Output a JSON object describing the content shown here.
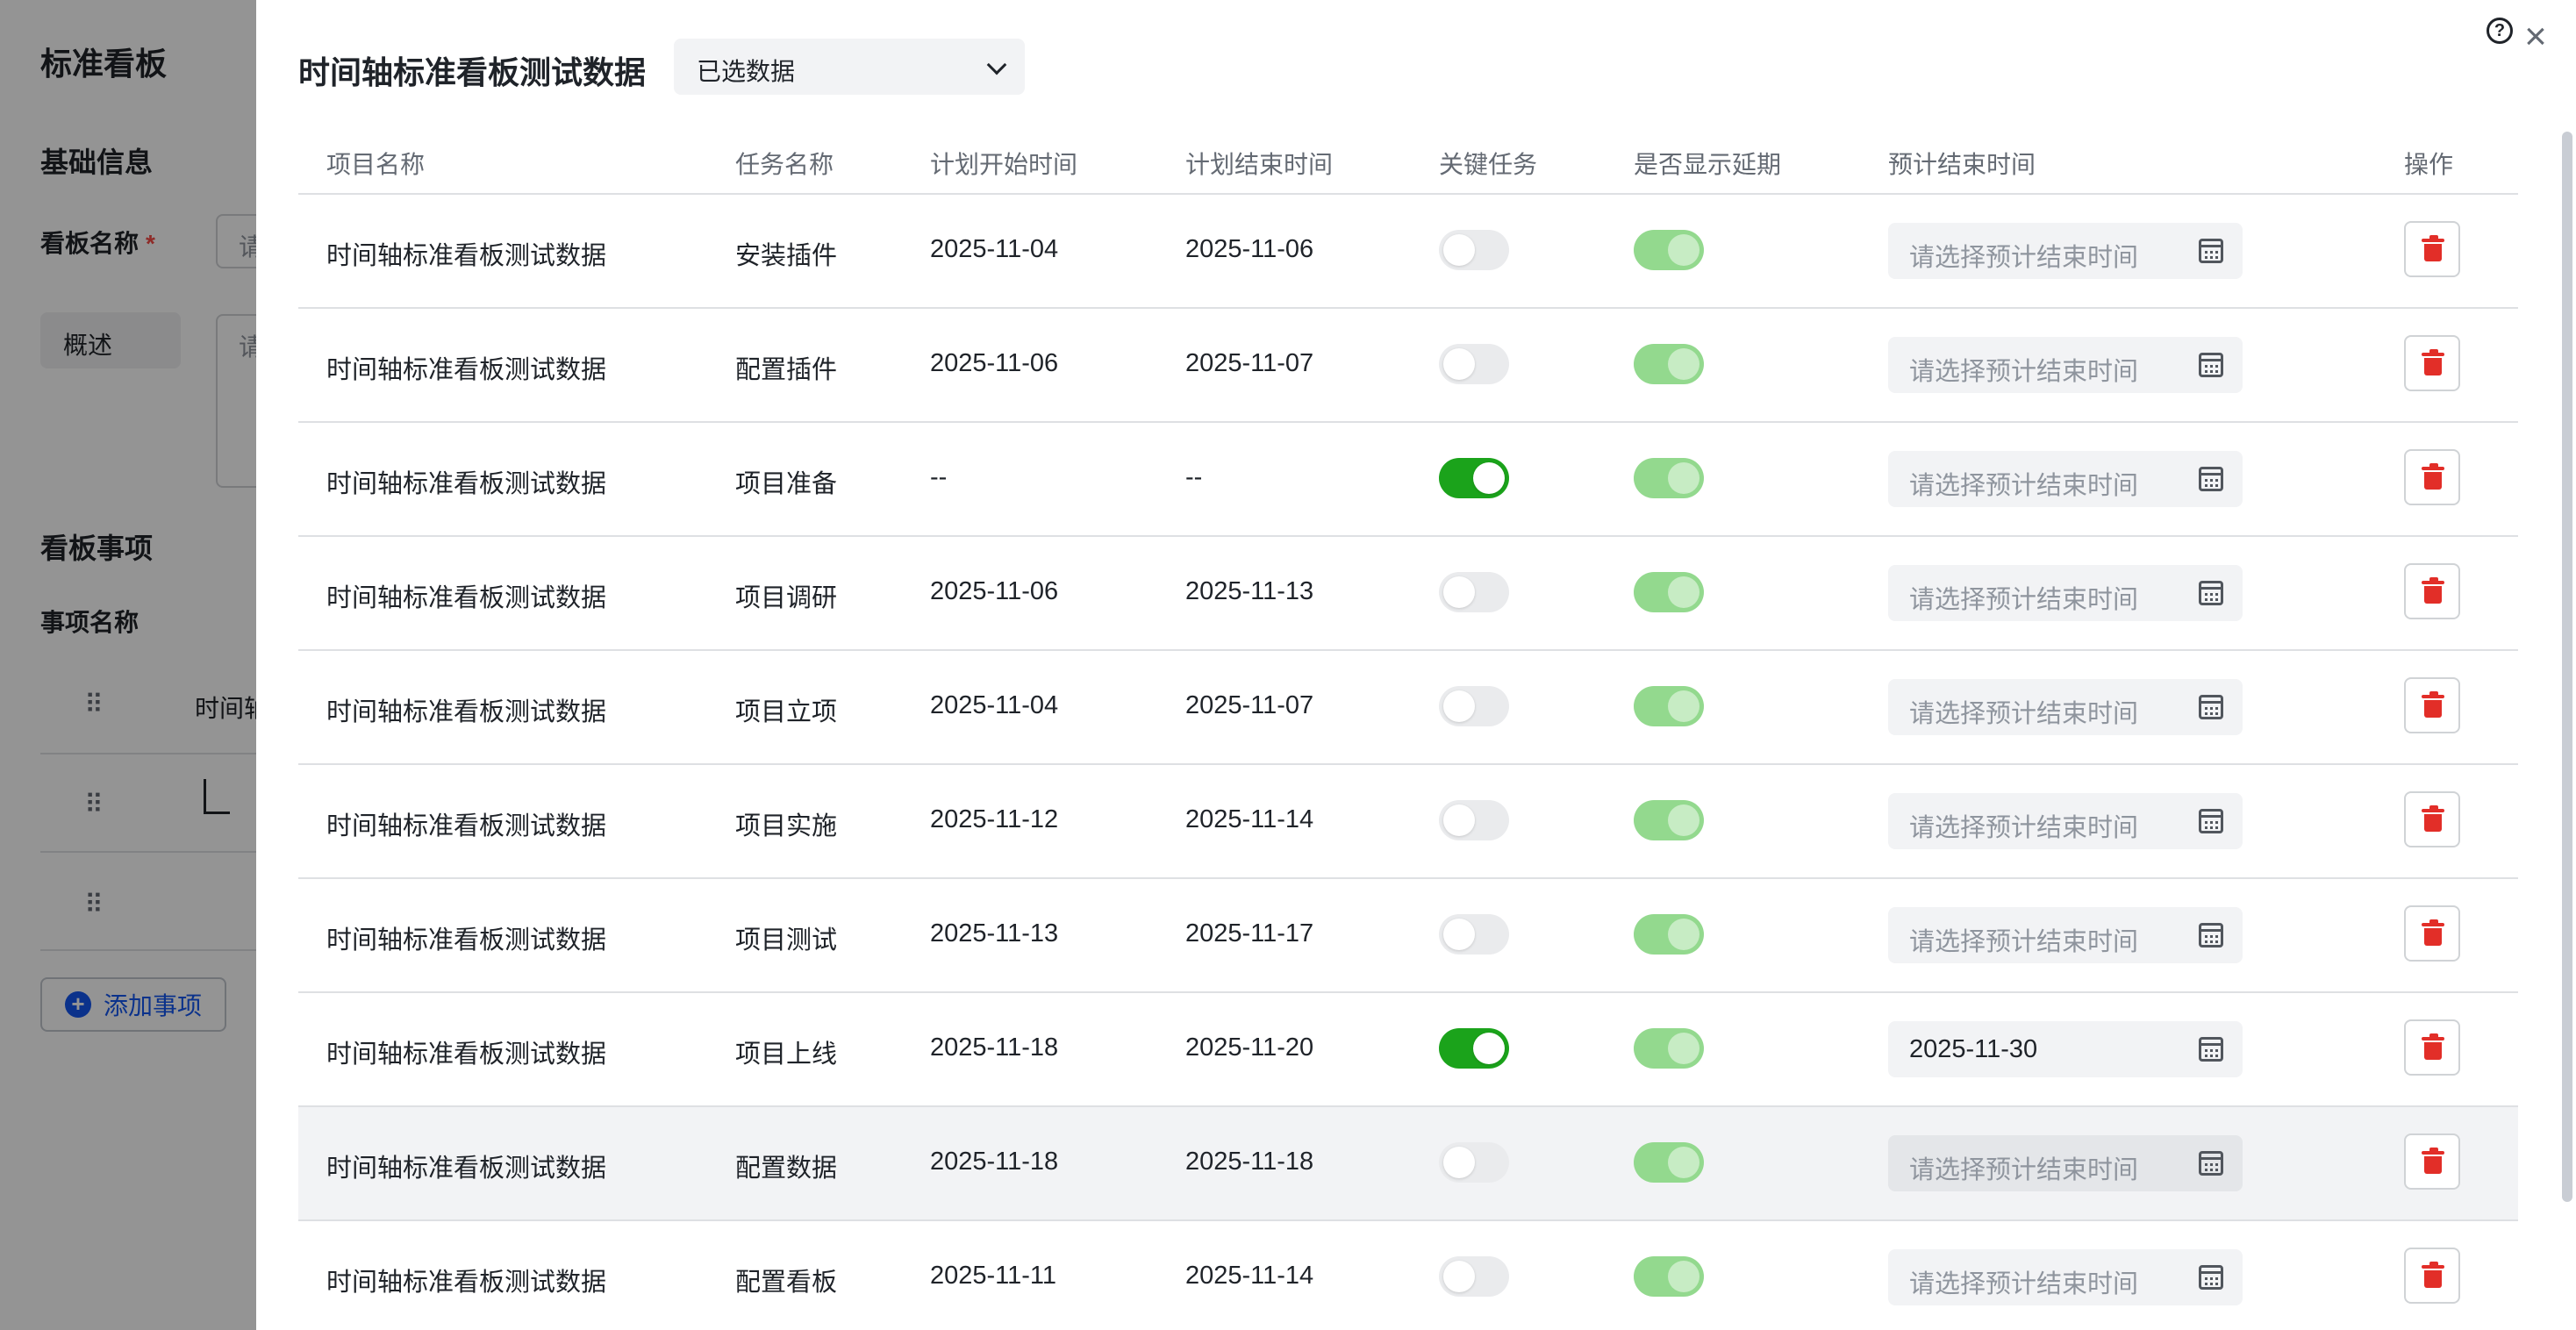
{
  "background": {
    "title": "标准看板",
    "section_basic": "基础信息",
    "board_name_label": "看板名称",
    "required_mark": "*",
    "board_name_placeholder_partial": "请",
    "overview_tag": "概述",
    "overview_placeholder_partial": "请",
    "section_items": "看板事项",
    "item_name_label": "事项名称",
    "first_item_partial": "时间轴",
    "add_item_button": "添加事项"
  },
  "drawer": {
    "title": "时间轴标准看板测试数据",
    "select_value": "已选数据",
    "help_icon": "?",
    "close_icon": "×"
  },
  "table": {
    "headers": [
      "项目名称",
      "任务名称",
      "计划开始时间",
      "计划结束时间",
      "关键任务",
      "是否显示延期",
      "预计结束时间",
      "操作"
    ],
    "date_placeholder": "请选择预计结束时间",
    "rows": [
      {
        "project": "时间轴标准看板测试数据",
        "task": "安装插件",
        "start": "2025-11-04",
        "end": "2025-11-06",
        "key_task": false,
        "show_delay": true,
        "expected_end": ""
      },
      {
        "project": "时间轴标准看板测试数据",
        "task": "配置插件",
        "start": "2025-11-06",
        "end": "2025-11-07",
        "key_task": false,
        "show_delay": true,
        "expected_end": ""
      },
      {
        "project": "时间轴标准看板测试数据",
        "task": "项目准备",
        "start": "--",
        "end": "--",
        "key_task": true,
        "show_delay": true,
        "expected_end": ""
      },
      {
        "project": "时间轴标准看板测试数据",
        "task": "项目调研",
        "start": "2025-11-06",
        "end": "2025-11-13",
        "key_task": false,
        "show_delay": true,
        "expected_end": ""
      },
      {
        "project": "时间轴标准看板测试数据",
        "task": "项目立项",
        "start": "2025-11-04",
        "end": "2025-11-07",
        "key_task": false,
        "show_delay": true,
        "expected_end": ""
      },
      {
        "project": "时间轴标准看板测试数据",
        "task": "项目实施",
        "start": "2025-11-12",
        "end": "2025-11-14",
        "key_task": false,
        "show_delay": true,
        "expected_end": ""
      },
      {
        "project": "时间轴标准看板测试数据",
        "task": "项目测试",
        "start": "2025-11-13",
        "end": "2025-11-17",
        "key_task": false,
        "show_delay": true,
        "expected_end": ""
      },
      {
        "project": "时间轴标准看板测试数据",
        "task": "项目上线",
        "start": "2025-11-18",
        "end": "2025-11-20",
        "key_task": true,
        "show_delay": true,
        "expected_end": "2025-11-30"
      },
      {
        "project": "时间轴标准看板测试数据",
        "task": "配置数据",
        "start": "2025-11-18",
        "end": "2025-11-18",
        "key_task": false,
        "show_delay": true,
        "expected_end": "",
        "highlighted": true
      },
      {
        "project": "时间轴标准看板测试数据",
        "task": "配置看板",
        "start": "2025-11-11",
        "end": "2025-11-14",
        "key_task": false,
        "show_delay": true,
        "expected_end": ""
      }
    ]
  },
  "colors": {
    "switch_on": "#1ba31b",
    "switch_on_disabled": "#93d98e",
    "delete_red": "#e22e28",
    "accent_blue": "#1456f0"
  }
}
